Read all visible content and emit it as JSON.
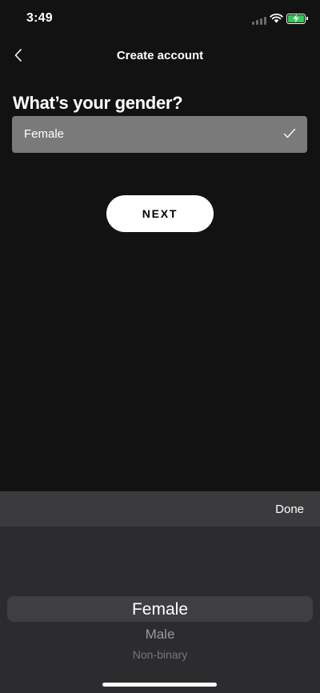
{
  "status_bar": {
    "time": "3:49",
    "icons": [
      "cellular-signal-icon",
      "wifi-icon",
      "battery-charging-icon"
    ],
    "battery_color": "#34c759"
  },
  "nav": {
    "back_icon": "chevron-left-icon",
    "title": "Create account"
  },
  "form": {
    "question": "What’s your gender?",
    "selected_value": "Female",
    "check_icon": "checkmark-icon",
    "field_color": "#7a7a7a"
  },
  "next_button": {
    "label": "NEXT"
  },
  "picker": {
    "done_label": "Done",
    "options": [
      "Female",
      "Male",
      "Non-binary"
    ],
    "selected_index": 0
  }
}
